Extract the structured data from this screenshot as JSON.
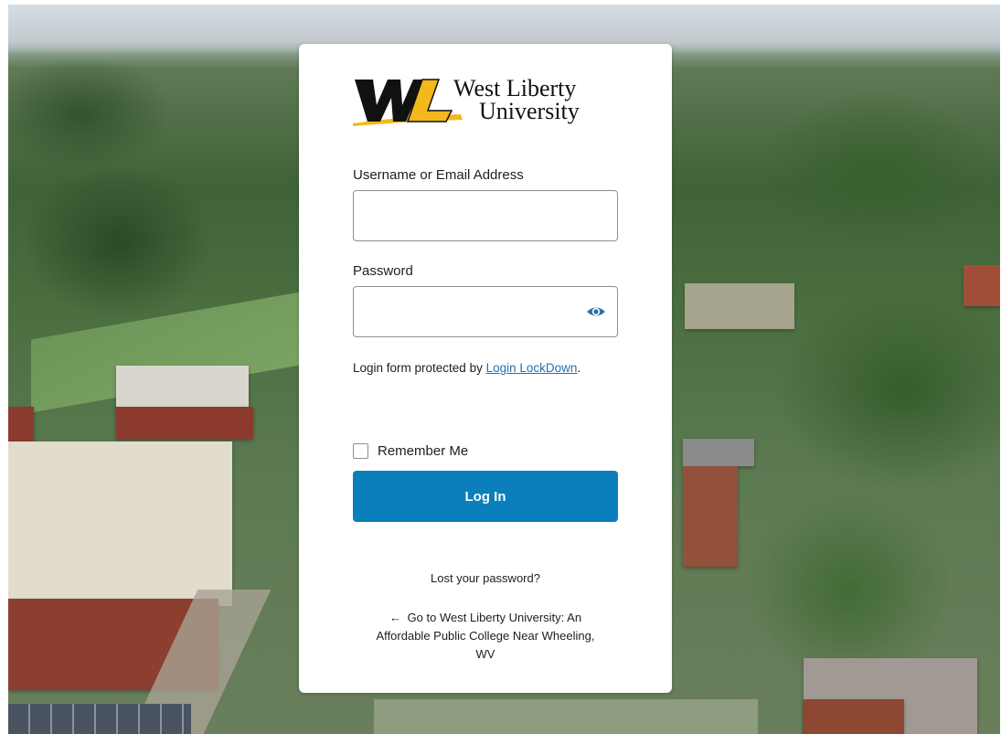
{
  "brand": {
    "logo_monogram": "WL",
    "logo_line1": "West Liberty",
    "logo_line2": "University",
    "colors": {
      "gold": "#f4b81c",
      "black": "#111111"
    }
  },
  "form": {
    "username_label": "Username or Email Address",
    "username_value": "",
    "password_label": "Password",
    "password_value": "",
    "show_password_icon": "eye-icon",
    "protection_text": "Login form protected by ",
    "protection_link": "Login LockDown",
    "protection_suffix": ".",
    "remember_label": "Remember Me",
    "remember_checked": false,
    "submit_label": "Log In"
  },
  "links": {
    "lost_password": "Lost your password?",
    "back_arrow": "←",
    "back_to_site": "Go to West Liberty University: An Affordable Public College Near Wheeling, WV"
  },
  "theme": {
    "primary_button": "#0a7fbb",
    "link_color": "#2271b1"
  }
}
